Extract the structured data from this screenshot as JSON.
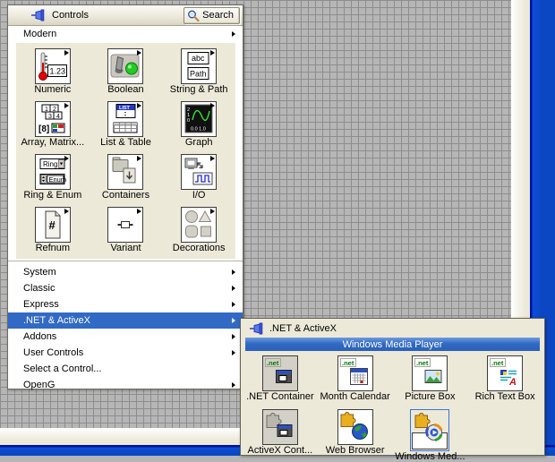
{
  "colors": {
    "selection_blue": "#316ac5",
    "window_border_blue": "#0b47c2",
    "grid_cell": "#b6b6b6",
    "grid_line": "#8d8d8d",
    "panel_beige": "#ece9d8"
  },
  "controls_palette": {
    "title": "Controls",
    "search_button_label": "Search",
    "modern": {
      "label": "Modern",
      "items": [
        {
          "label": "Numeric"
        },
        {
          "label": "Boolean"
        },
        {
          "label": "String & Path"
        },
        {
          "label": "Array, Matrix..."
        },
        {
          "label": "List & Table"
        },
        {
          "label": "Graph"
        },
        {
          "label": "Ring & Enum"
        },
        {
          "label": "Containers"
        },
        {
          "label": "I/O"
        },
        {
          "label": "Refnum"
        },
        {
          "label": "Variant"
        },
        {
          "label": "Decorations"
        }
      ]
    },
    "menu_items": [
      {
        "label": "System"
      },
      {
        "label": "Classic"
      },
      {
        "label": "Express"
      },
      {
        "label": ".NET & ActiveX",
        "selected": true
      },
      {
        "label": "Addons"
      },
      {
        "label": "User Controls"
      },
      {
        "label": "Select a Control..."
      },
      {
        "label": "OpenG"
      }
    ]
  },
  "net_activex_palette": {
    "title": ".NET & ActiveX",
    "section_header": "Windows Media Player",
    "row1": [
      {
        "label": ".NET Container"
      },
      {
        "label": "Month Calendar"
      },
      {
        "label": "Picture Box"
      },
      {
        "label": "Rich Text Box"
      }
    ],
    "row2": [
      {
        "label": "ActiveX Cont..."
      },
      {
        "label": "Web Browser"
      },
      {
        "label": "Windows Med...",
        "selected": true
      }
    ]
  },
  "glyph_text": {
    "numeric": "1.23",
    "abc": "abc",
    "path": "Path",
    "list": "LIST",
    "ring": "Ring",
    "enum": "Enum",
    "refnum": "#",
    "net": ".net",
    "letter_a": "A",
    "array_digits": [
      "1",
      "2",
      "3",
      "4"
    ]
  }
}
